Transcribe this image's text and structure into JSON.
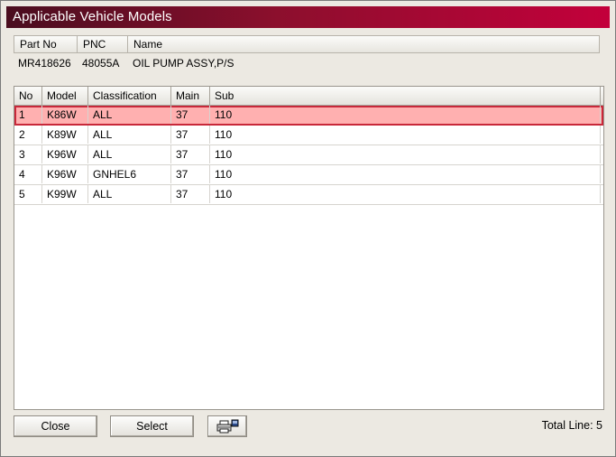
{
  "window": {
    "title": "Applicable Vehicle Models"
  },
  "part_header": {
    "columns": [
      "Part No",
      "PNC",
      "Name"
    ],
    "values": [
      "MR418626",
      "48055A",
      "OIL PUMP ASSY,P/S"
    ]
  },
  "grid": {
    "columns": [
      "No",
      "Model",
      "Classification",
      "Main",
      "Sub"
    ],
    "rows": [
      [
        "1",
        "K86W",
        "ALL",
        "37",
        "110"
      ],
      [
        "2",
        "K89W",
        "ALL",
        "37",
        "110"
      ],
      [
        "3",
        "K96W",
        "ALL",
        "37",
        "110"
      ],
      [
        "4",
        "K96W",
        "GNHEL6",
        "37",
        "110"
      ],
      [
        "5",
        "K99W",
        "ALL",
        "37",
        "110"
      ]
    ],
    "selected_row_index": 0,
    "selected_color": "#ffb0b0"
  },
  "buttons": {
    "close": "Close",
    "select": "Select",
    "print_icon": "printer-icon"
  },
  "status": {
    "total": "Total Line: 5"
  },
  "colors": {
    "title_start": "#4a0d1f",
    "title_end": "#c3003b",
    "selection_border": "#c8283a"
  }
}
